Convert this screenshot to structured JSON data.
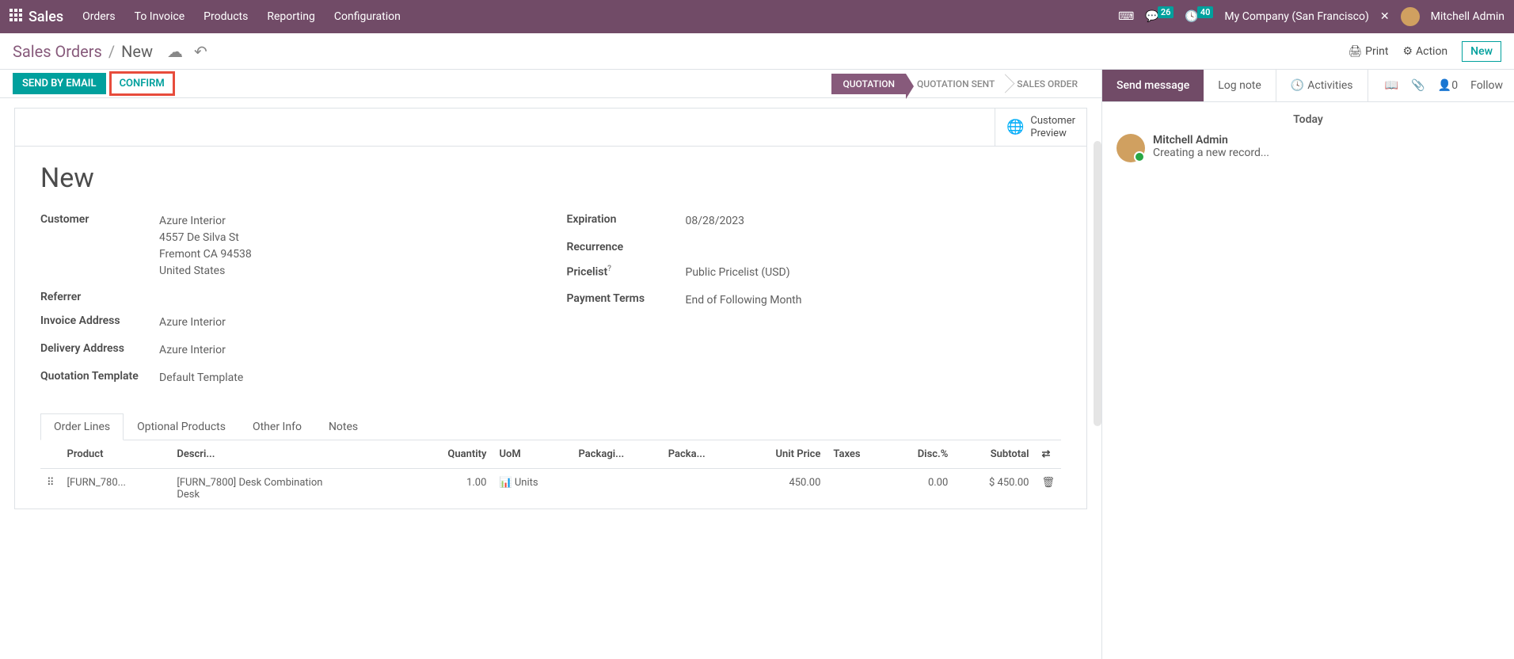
{
  "top": {
    "appname": "Sales",
    "menu": [
      "Orders",
      "To Invoice",
      "Products",
      "Reporting",
      "Configuration"
    ],
    "chat_badge": "26",
    "clock_badge": "40",
    "company": "My Company (San Francisco)",
    "user": "Mitchell Admin"
  },
  "breadcrumb": {
    "root": "Sales Orders",
    "current": "New"
  },
  "tools": {
    "print": "Print",
    "action": "Action",
    "new": "New"
  },
  "statusbar": {
    "send_email": "SEND BY EMAIL",
    "confirm": "CONFIRM",
    "stages": [
      "QUOTATION",
      "QUOTATION SENT",
      "SALES ORDER"
    ]
  },
  "customer_preview": {
    "l1": "Customer",
    "l2": "Preview"
  },
  "title": "New",
  "left": {
    "customer_label": "Customer",
    "customer_name": "Azure Interior",
    "customer_street": "4557 De Silva St",
    "customer_city": "Fremont CA 94538",
    "customer_country": "United States",
    "referrer_label": "Referrer",
    "invoice_label": "Invoice Address",
    "invoice_val": "Azure Interior",
    "delivery_label": "Delivery Address",
    "delivery_val": "Azure Interior",
    "template_label": "Quotation Template",
    "template_val": "Default Template"
  },
  "right": {
    "expiration_label": "Expiration",
    "expiration_val": "08/28/2023",
    "recurrence_label": "Recurrence",
    "pricelist_label": "Pricelist",
    "pricelist_val": "Public Pricelist (USD)",
    "payment_label": "Payment Terms",
    "payment_val": "End of Following Month"
  },
  "tabs": [
    "Order Lines",
    "Optional Products",
    "Other Info",
    "Notes"
  ],
  "cols": {
    "product": "Product",
    "desc": "Descri...",
    "qty": "Quantity",
    "uom": "UoM",
    "pkgi": "Packagi...",
    "pkg": "Packa...",
    "unit": "Unit Price",
    "taxes": "Taxes",
    "disc": "Disc.%",
    "sub": "Subtotal"
  },
  "row": {
    "product": "[FURN_780...",
    "desc": "[FURN_7800] Desk Combination\nDesk",
    "qty": "1.00",
    "uom": "Units",
    "unit": "450.00",
    "disc": "0.00",
    "sub": "$ 450.00"
  },
  "chatter": {
    "send": "Send message",
    "log": "Log note",
    "act": "Activities",
    "followcount": "0",
    "follow": "Follow",
    "today": "Today",
    "author": "Mitchell Admin",
    "body": "Creating a new record..."
  }
}
